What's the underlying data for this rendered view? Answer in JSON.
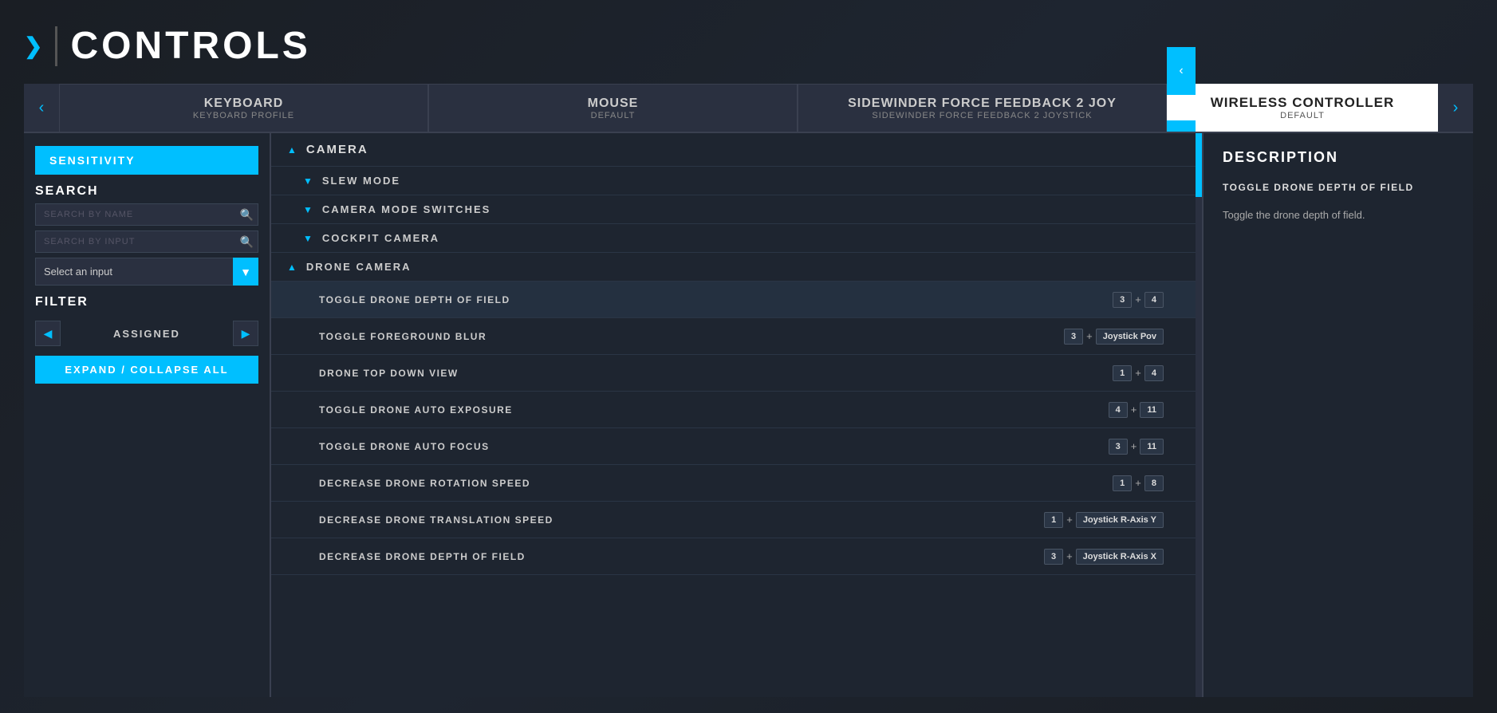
{
  "header": {
    "arrow": "❯",
    "divider": "|",
    "title": "CONTROLS"
  },
  "tabs": [
    {
      "id": "keyboard",
      "name": "KEYBOARD",
      "profile": "KEYBOARD PROFILE",
      "active": false
    },
    {
      "id": "mouse",
      "name": "MOUSE",
      "profile": "DEFAULT",
      "active": false
    },
    {
      "id": "sidewinder",
      "name": "SIDEWINDER FORCE FEEDBACK 2 JOY",
      "profile": "SIDEWINDER FORCE FEEDBACK 2 JOYSTICK",
      "active": false
    },
    {
      "id": "wireless",
      "name": "WIRELESS CONTROLLER",
      "profile": "DEFAULT",
      "active": true
    }
  ],
  "left_panel": {
    "sensitivity_label": "SENSITIVITY",
    "search_section_label": "SEARCH",
    "search_by_name_placeholder": "SEARCH BY NAME",
    "search_by_input_placeholder": "SEARCH BY INPUT",
    "select_input_label": "Select an input",
    "filter_section_label": "FILTER",
    "filter_prev": "◀",
    "filter_label": "ASSIGNED",
    "filter_next": "▶",
    "expand_label": "EXPAND / COLLAPSE ALL"
  },
  "categories": [
    {
      "id": "camera",
      "label": "CAMERA",
      "expanded": true,
      "arrow": "▲",
      "subcategories": [
        {
          "id": "slew-mode",
          "label": "SLEW MODE",
          "expanded": false,
          "arrow": "▼",
          "bindings": []
        },
        {
          "id": "camera-mode-switches",
          "label": "CAMERA MODE SWITCHES",
          "expanded": false,
          "arrow": "▼",
          "bindings": []
        },
        {
          "id": "cockpit-camera",
          "label": "COCKPIT CAMERA",
          "expanded": false,
          "arrow": "▼",
          "bindings": []
        },
        {
          "id": "drone-camera",
          "label": "DRONE CAMERA",
          "expanded": true,
          "arrow": "▲",
          "bindings": [
            {
              "id": "toggle-drone-dof",
              "name": "TOGGLE DRONE DEPTH OF FIELD",
              "keys": [
                {
                  "label": "3"
                },
                {
                  "sep": "+"
                },
                {
                  "label": "4"
                }
              ],
              "selected": true
            },
            {
              "id": "toggle-foreground-blur",
              "name": "TOGGLE FOREGROUND BLUR",
              "keys": [
                {
                  "label": "3"
                },
                {
                  "sep": "+"
                },
                {
                  "label": "Joystick Pov"
                }
              ],
              "selected": false
            },
            {
              "id": "drone-top-down",
              "name": "DRONE TOP DOWN VIEW",
              "keys": [
                {
                  "label": "1"
                },
                {
                  "sep": "+"
                },
                {
                  "label": "4"
                }
              ],
              "selected": false
            },
            {
              "id": "toggle-drone-auto-exposure",
              "name": "TOGGLE DRONE AUTO EXPOSURE",
              "keys": [
                {
                  "label": "4"
                },
                {
                  "sep": "+"
                },
                {
                  "label": "11"
                }
              ],
              "selected": false
            },
            {
              "id": "toggle-drone-auto-focus",
              "name": "TOGGLE DRONE AUTO FOCUS",
              "keys": [
                {
                  "label": "3"
                },
                {
                  "sep": "+"
                },
                {
                  "label": "11"
                }
              ],
              "selected": false
            },
            {
              "id": "decrease-drone-rotation-speed",
              "name": "DECREASE DRONE ROTATION SPEED",
              "keys": [
                {
                  "label": "1"
                },
                {
                  "sep": "+"
                },
                {
                  "label": "8"
                }
              ],
              "selected": false
            },
            {
              "id": "decrease-drone-translation-speed",
              "name": "DECREASE DRONE TRANSLATION SPEED",
              "keys": [
                {
                  "label": "1"
                },
                {
                  "sep": "+"
                },
                {
                  "label": "Joystick R-Axis Y"
                }
              ],
              "selected": false
            },
            {
              "id": "decrease-drone-dof",
              "name": "DECREASE DRONE DEPTH OF FIELD",
              "keys": [
                {
                  "label": "3"
                },
                {
                  "sep": "+"
                },
                {
                  "label": "Joystick R-Axis X"
                }
              ],
              "selected": false
            }
          ]
        }
      ]
    }
  ],
  "description": {
    "title": "DESCRIPTION",
    "action_name": "TOGGLE DRONE DEPTH OF FIELD",
    "text": "Toggle the drone depth of field."
  },
  "colors": {
    "accent": "#00bfff",
    "bg_dark": "#1a1e24",
    "bg_panel": "#1e2530",
    "bg_input": "#2a3040",
    "text_primary": "#ffffff",
    "text_secondary": "#cccccc",
    "text_muted": "#888888"
  }
}
